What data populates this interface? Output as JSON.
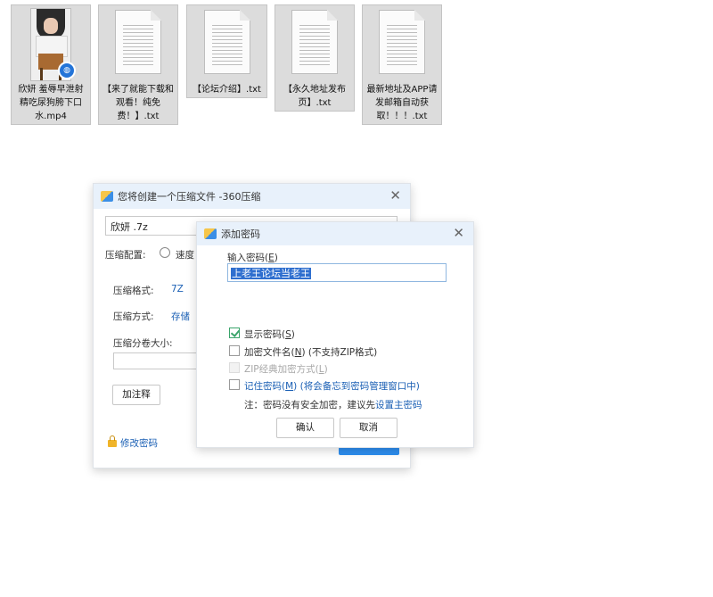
{
  "desktop": {
    "files": [
      {
        "name": "欣妍 羞辱早泄射精吃尿狗胯下口水.mp4",
        "type": "video",
        "icon": "video-thumbnail-icon",
        "badge_icon": "qq-player-badge-icon"
      },
      {
        "name": "【来了就能下载和观看！纯免费！】.txt",
        "type": "text",
        "icon": "text-file-icon"
      },
      {
        "name": "【论坛介绍】.txt",
        "type": "text",
        "icon": "text-file-icon"
      },
      {
        "name": "【永久地址发布页】.txt",
        "type": "text",
        "icon": "text-file-icon"
      },
      {
        "name": "最新地址及APP请发邮箱自动获取！！！.txt",
        "type": "text",
        "icon": "text-file-icon"
      }
    ]
  },
  "archive_dialog": {
    "title": "您将创建一个压缩文件 -360压缩",
    "filename": "欣妍 .7z",
    "config_label": "压缩配置:",
    "speed_option": "速度",
    "format_label": "压缩格式:",
    "format_value": "7Z",
    "method_label": "压缩方式:",
    "method_value": "存储",
    "split_label": "压缩分卷大小:",
    "split_value": "",
    "comment_button": "加注释",
    "change_password_link": "修改密码"
  },
  "password_dialog": {
    "title": "添加密码",
    "input_label": "输入密码",
    "input_shortcut": "E",
    "password_value": "上老王论坛当老王",
    "show_password_label": "显示密码",
    "show_password_shortcut": "S",
    "show_password_checked": true,
    "encrypt_names_label": "加密文件名",
    "encrypt_names_shortcut": "N",
    "encrypt_names_note": "(不支持ZIP格式)",
    "zip_classic_label": "ZIP经典加密方式",
    "zip_classic_shortcut": "L",
    "remember_label": "记住密码",
    "remember_shortcut": "M",
    "remember_note": "(将会备忘到密码管理窗口中)",
    "note_text": "注：密码没有安全加密，建议先",
    "note_link": "设置主密码",
    "ok_button": "确认",
    "cancel_button": "取消"
  },
  "colors": {
    "titlebar_bg": "#e8f1fb",
    "link": "#1a5fb4",
    "accent_blue": "#2d8ef0",
    "check_green": "#3aa46a",
    "selection": "#2f6fcf"
  }
}
